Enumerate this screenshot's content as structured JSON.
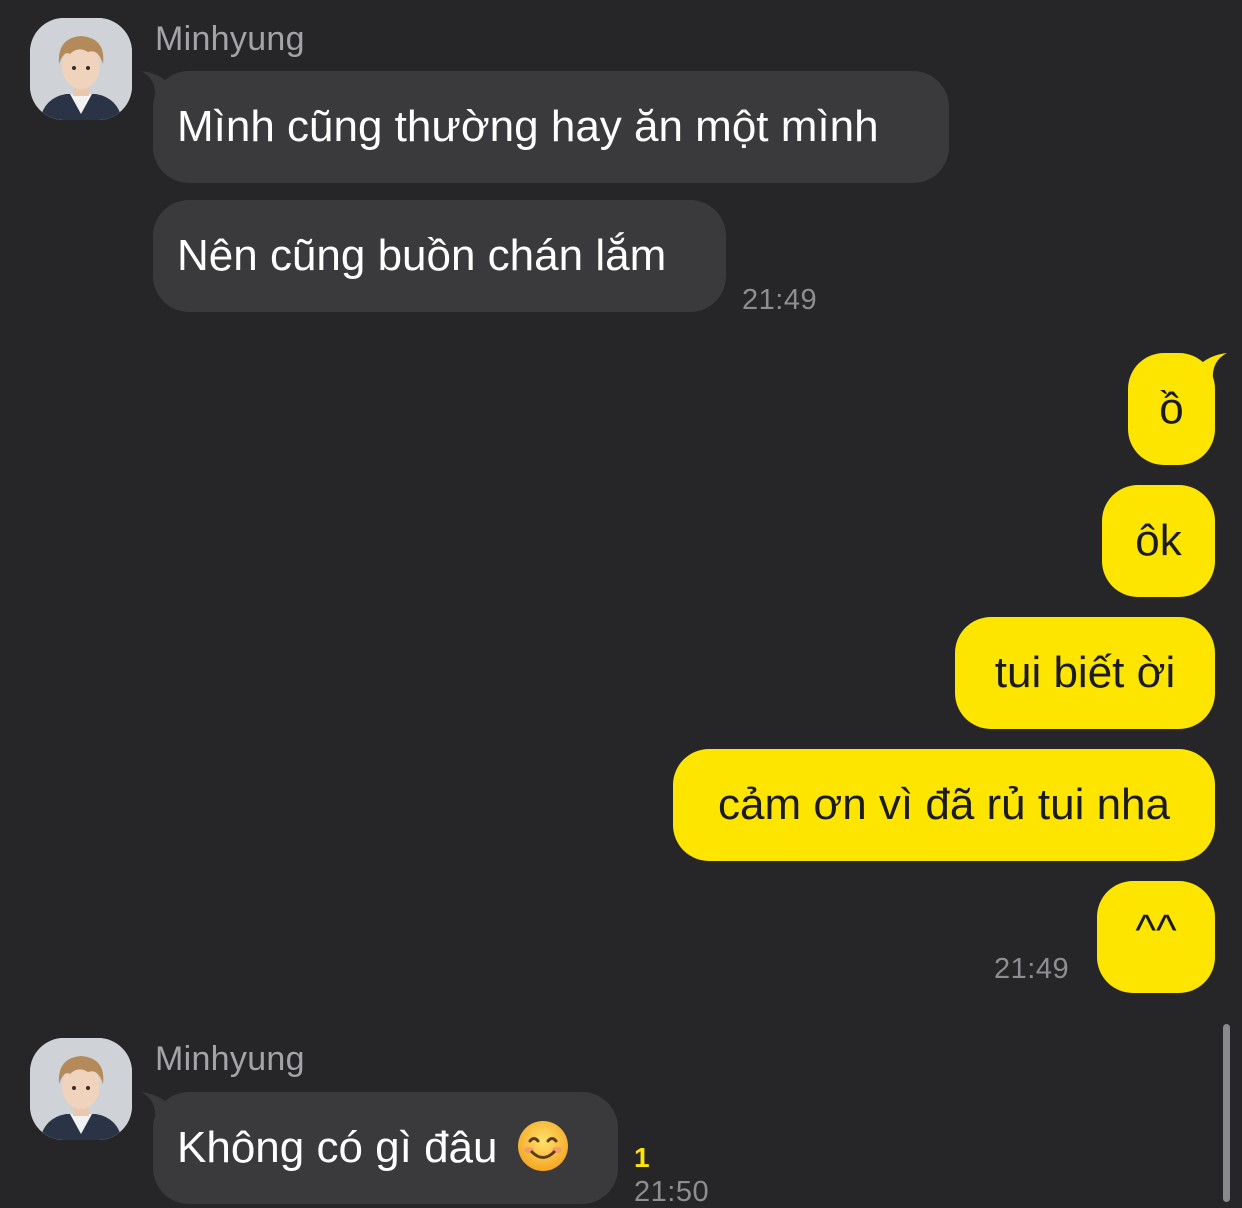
{
  "colors": {
    "background": "#262628",
    "incoming_bubble": "#3a3a3c",
    "outgoing_bubble": "#fee500",
    "unread_badge": "#fee500"
  },
  "groups": [
    {
      "sender": "Minhyung",
      "direction": "incoming",
      "messages": [
        "Mình cũng thường hay ăn một mình",
        "Nên cũng buồn chán lắm"
      ],
      "time": "21:49"
    },
    {
      "direction": "outgoing",
      "messages": [
        "ồ",
        "ôk",
        "tui biết ời",
        "cảm ơn vì đã rủ tui nha",
        "^^"
      ],
      "time": "21:49"
    },
    {
      "sender": "Minhyung",
      "direction": "incoming",
      "messages": [
        "Không có gì đâu"
      ],
      "emoji": "smiling-face-emoji",
      "unread_count": "1",
      "time": "21:50"
    }
  ]
}
